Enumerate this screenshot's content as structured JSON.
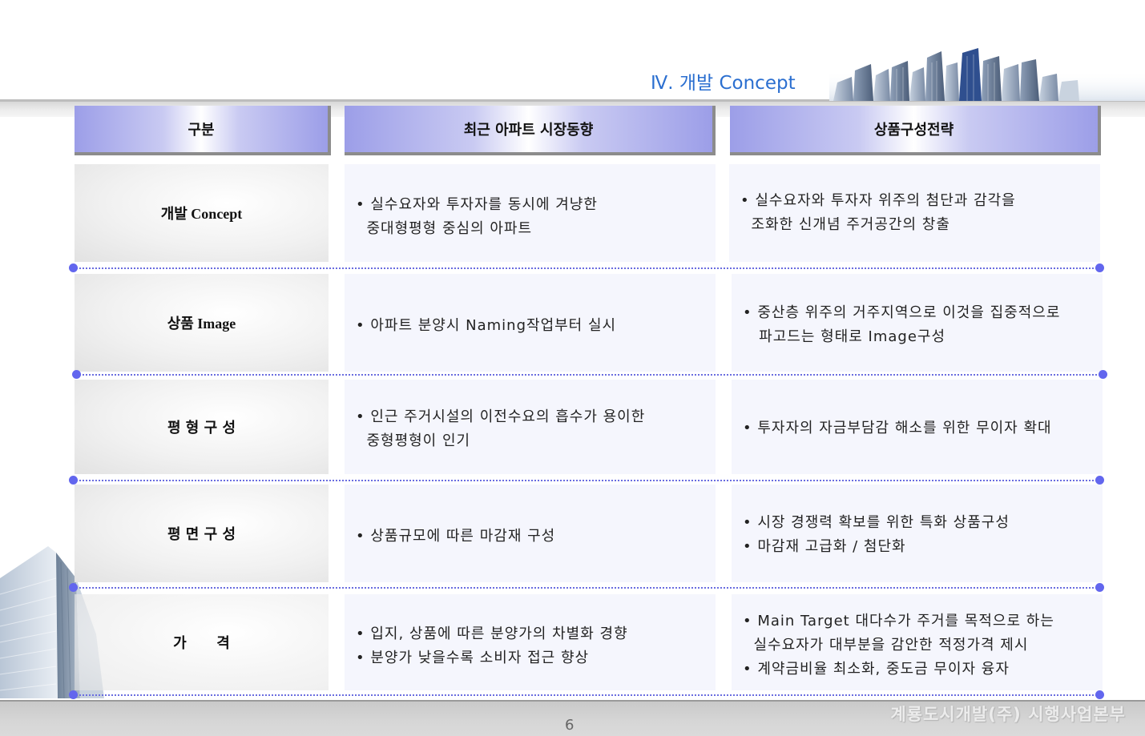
{
  "page": {
    "title": "Ⅳ. 개발 Concept",
    "page_number": "6",
    "footer_org": "계룡도시개발(주) 시행사업본부",
    "accent_color": "#2b6fd0",
    "header_color": "#9c9ee8",
    "separator_color": "#6266ee"
  },
  "table": {
    "headers": [
      "구분",
      "최근 아파트 시장동향",
      "상품구성전략"
    ],
    "rows": [
      {
        "label": "개발 Concept",
        "trend": [
          "• 실수요자와 투자자를 동시에 겨냥한",
          "  중대형평형 중심의 아파트"
        ],
        "strategy": [
          "• 실수요자와 투자자 위주의 첨단과 감각을",
          "  조화한 신개념 주거공간의 창출"
        ]
      },
      {
        "label": "상품 Image",
        "trend": [
          "• 아파트 분양시 Naming작업부터 실시"
        ],
        "strategy": [
          "• 중산층 위주의 거주지역으로 이것을 집중적으로",
          "   파고드는 형태로 Image구성"
        ]
      },
      {
        "label": "평 형 구 성",
        "trend": [
          "• 인근 주거시설의 이전수요의 흡수가 용이한",
          "  중형평형이 인기"
        ],
        "strategy": [
          "• 투자자의 자금부담감 해소를 위한 무이자 확대"
        ]
      },
      {
        "label": "평 면 구 성",
        "trend": [
          "• 상품규모에 따른 마감재 구성"
        ],
        "strategy": [
          "• 시장 경쟁력 확보를 위한 특화 상품구성",
          "• 마감재 고급화 / 첨단화"
        ]
      },
      {
        "label": "가      격",
        "trend": [
          "• 입지, 상품에 따른 분양가의 차별화 경향",
          "• 분양가 낮을수록 소비자 접근 향상"
        ],
        "strategy": [
          "• Main Target 대다수가 주거를 목적으로 하는",
          "  실수요자가 대부분을 감안한 적정가격 제시",
          "• 계약금비율 최소화, 중도금 무이자 융자"
        ]
      }
    ]
  }
}
